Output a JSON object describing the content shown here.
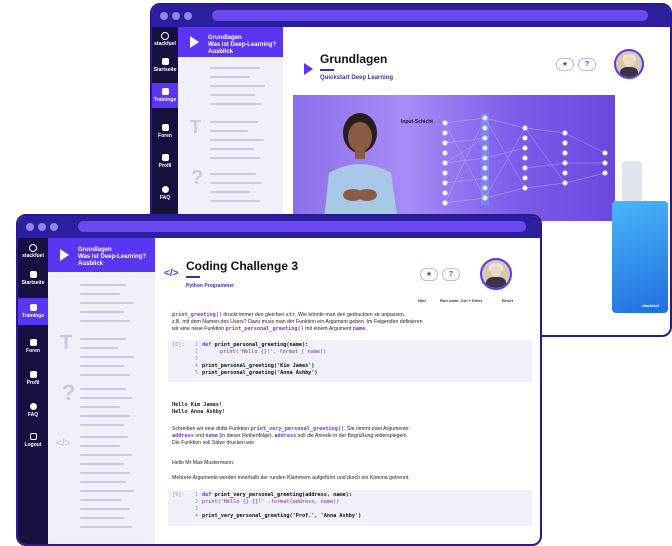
{
  "brand": "stackfuel",
  "rail_items": [
    "Startseite",
    "Trainings",
    "Foren",
    "Profil",
    "FAQ",
    "Logout"
  ],
  "back_window": {
    "nav": {
      "heading": "Grundlagen",
      "lines": [
        "Was ist Deep-Learning?",
        "Ausblick"
      ]
    },
    "page_title": "Grundlagen",
    "subtitle": "Quickstart Deep Learning",
    "video_label": "Input-Schicht",
    "side_card_brand": "stackfuel"
  },
  "front_window": {
    "nav": {
      "heading": "Grundlagen",
      "lines": [
        "Was ist Deep-Learning?",
        "Ausblick"
      ]
    },
    "page_title": "Coding Challenge 3",
    "subtitle": "Python Programmer",
    "code_icon": "</>",
    "toolbar": {
      "hint": "Hint",
      "run": "Run code: Ctrl + Enter",
      "reset": "Reset"
    },
    "intro": {
      "code1": "print_greeting()",
      "text1": " druckt immer den gleichen ",
      "code2": "str",
      "text2": ". Wie könnte man den gedruckten str anpassen,",
      "line2": "z.B. mit dem Namen des Users? Dazu muss man der Funktion ein Argument geben. Im Folgenden definieren",
      "line3a": "wir eine neue Funktion ",
      "code3": "print_personal_greeting()",
      "line3b": " mit einem Argument ",
      "code4": "name",
      "line3c": "."
    },
    "cell1": {
      "prompt": "[6]:",
      "l1_num": "1",
      "l1_kw": "def",
      "l1_rest": " print_personal_greeting(name):",
      "l2_num": "2",
      "l2_code": "print('Hello {}!'. format ( name))",
      "l3_num": "3",
      "l4_num": "4",
      "l4_code": "print_personal_greeting('Kim James')",
      "l5_num": "5",
      "l5_code": "print_personal_greeting('Anna Ashby')"
    },
    "output": [
      "Hello Kim James!",
      "Hello Anna Ashby!"
    ],
    "task": {
      "a": "Schreiben wir eine dritte Funktion ",
      "a_code": "print_very_personal_greeting()",
      "b": ". Sie nimmt zwei Argumente:",
      "c_code1": "address",
      "c1": " und ",
      "c_code2": "name",
      "c2": " (in dieser Reihenfolge). ",
      "c_code3": "address",
      "c3": " soll die Anrede in der Begrüßung widerspiegeln.",
      "d": "Die Funktion soll Sätze drucken wie"
    },
    "example": "Hello Mr Max Mustermann:",
    "note": "Mehrere Argumente werden innerhalb der runden Klammern aufgeführt und durch ein Komma getrennt.",
    "cell2": {
      "prompt": "[9]:",
      "l1_num": "1",
      "l1_kw": "def",
      "l1_rest": " print_very_personal_greeting(address, name):",
      "l2_num": "2",
      "l2_code": "print('Hello {} {}!' .format(address, name))",
      "l3_num": "3",
      "l4_num": "4",
      "l4_code": "print_very_personal_greeting('Prof.', 'Anna Ashby')"
    }
  }
}
